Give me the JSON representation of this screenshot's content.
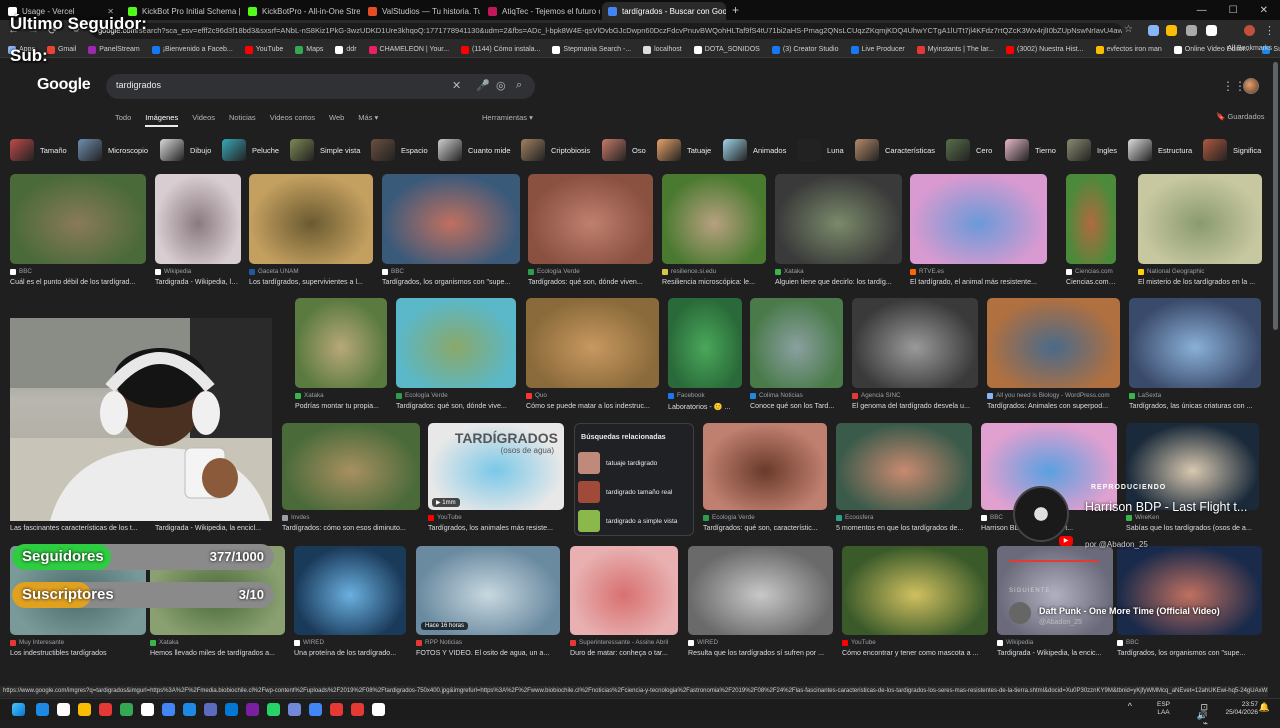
{
  "browser": {
    "tabs": [
      {
        "title": "Usage - Vercel",
        "color": "#ffffff",
        "active": false
      },
      {
        "title": "KickBot Pro Initial Schema | SQL",
        "color": "#53fc18",
        "active": false
      },
      {
        "title": "KickBotPro - All-in-One Stream",
        "color": "#53fc18",
        "active": false
      },
      {
        "title": "ValStudios — Tu historia. Tu cli",
        "color": "#e44d26",
        "active": false
      },
      {
        "title": "AtiqTec - Tejemos el futuro con",
        "color": "#c2185b",
        "active": false
      },
      {
        "title": "tardígrados - Buscar con Google",
        "color": "#4285f4",
        "active": true
      }
    ],
    "new_tab_label": "+",
    "window_controls": [
      "—",
      "☐",
      "✕"
    ],
    "url_host": "google.com",
    "url_rest": "/search?sca_esv=efff2c96d3f18bd3&sxsrf=ANbL-nS8Kiz1PkG-3wzUDKD1Ure3khqoQ:1771778941130&udm=2&fbs=ADc_l-bpk8W4E-qsVlOvbGJcDwpn60DczFdcvPnuvBWQohHLTaf9fS4tU71bi2aHS-Pmag2QNsLCUqzZKqmjKDQ4UhwYCTgA1lUTt7jl4KFdz7rtQZcK3Wx4rjlI0bZUpNswNrIavU4awiu2122OpNPwAtPVaLTGydP",
    "bookmarks": [
      {
        "label": "Apps",
        "color": "#8ab4f8"
      },
      {
        "label": "Gmail",
        "color": "#ea4335"
      },
      {
        "label": "PanelStream",
        "color": "#9c27b0"
      },
      {
        "label": "¡Bienvenido a Faceb...",
        "color": "#1877f2"
      },
      {
        "label": "YouTube",
        "color": "#ff0000"
      },
      {
        "label": "Maps",
        "color": "#34a853"
      },
      {
        "label": "ddr",
        "color": "#ffffff"
      },
      {
        "label": "CHAMELEON | Your...",
        "color": "#e91e63"
      },
      {
        "label": "(1144) Cómo instala...",
        "color": "#ff0000"
      },
      {
        "label": "Stepmania Search -...",
        "color": "#ffffff"
      },
      {
        "label": "localhost",
        "color": "#dddddd"
      },
      {
        "label": "DOTA_SONIDOS",
        "color": "#ffffff"
      },
      {
        "label": "(3) Creator Studio",
        "color": "#1877f2"
      },
      {
        "label": "Live Producer",
        "color": "#1877f2"
      },
      {
        "label": "Myinstants | The lar...",
        "color": "#e53935"
      },
      {
        "label": "(3002) Nuestra Hist...",
        "color": "#ff0000"
      },
      {
        "label": "evfectos iron man",
        "color": "#fbbc04"
      },
      {
        "label": "Online Video Editor...",
        "color": "#ffffff"
      },
      {
        "label": "Submarine Cable M...",
        "color": "#1e88e5"
      }
    ],
    "all_bookmarks": "All Bookmarks",
    "status_url": "https://www.google.com/imgres?q=tardigrados&imgurl=https%3A%2F%2Fmedia.biobiochile.cl%2Fwp-content%2Fuploads%2F2019%2F08%2Ftardigrados-750x400.jpg&imgrefurl=https%3A%2F%2Fwww.biobiochile.cl%2Fnoticias%2Fciencia-y-tecnologia%2Fastronomia%2F2019%2F08%2F24%2Flas-fascinantes-caracteristicas-de-los-tardigrados-los-seres-mas-resistentes-de-la-tierra.shtml&docid=Xu0P30zznKY9M&tbnid=yKjfyWMMcq_aNEvet=12ahUKEwi-hq5-24gUAxW3r..."
  },
  "google": {
    "logo": "Google",
    "query": "tardigrados",
    "nav": [
      "Todo",
      "Imágenes",
      "Videos",
      "Noticias",
      "Videos cortos",
      "Web",
      "Más ▾"
    ],
    "active_nav": "Imágenes",
    "tools": "Herramientas ▾",
    "saved": "Guardados",
    "chips": [
      {
        "label": "Tamaño",
        "color": "#c04a4a"
      },
      {
        "label": "Microscopio",
        "color": "#6f8fb0"
      },
      {
        "label": "Dibujo",
        "color": "#d9d9d9"
      },
      {
        "label": "Peluche",
        "color": "#3aa7b8"
      },
      {
        "label": "Simple vista",
        "color": "#7d8a55"
      },
      {
        "label": "Espacio",
        "color": "#6a5040"
      },
      {
        "label": "Cuanto mide",
        "color": "#cfcfcf"
      },
      {
        "label": "Criptobiosis",
        "color": "#a08060"
      },
      {
        "label": "Oso",
        "color": "#c77a6a"
      },
      {
        "label": "Tatuaje",
        "color": "#e6a36a"
      },
      {
        "label": "Animados",
        "color": "#9ed3e8"
      },
      {
        "label": "Luna",
        "color": "#222222"
      },
      {
        "label": "Características",
        "color": "#b48a6a"
      },
      {
        "label": "Cero",
        "color": "#59704a"
      },
      {
        "label": "Tierno",
        "color": "#e6b8c8"
      },
      {
        "label": "Ingles",
        "color": "#8c8c70"
      },
      {
        "label": "Estructura",
        "color": "#dddddd"
      },
      {
        "label": "Significa",
        "color": "#b0593e"
      }
    ],
    "results": [
      {
        "source": "BBC",
        "title": "Cuál es el punto débil de los tardígrad...",
        "fav": "#ffffff",
        "g": "#4a6a3a,#8a7a5a"
      },
      {
        "source": "Wikipedia",
        "title": "Tardigrada - Wikipedia, la encicl...",
        "fav": "#ffffff",
        "g": "#d8cdd0,#8a7a80"
      },
      {
        "source": "Gaceta UNAM",
        "title": "Los tardígrados, supervivientes a l...",
        "fav": "#1e5aa0",
        "g": "#c4a060,#6a5a30"
      },
      {
        "source": "BBC",
        "title": "Tardígrados, los organismos con \"supe...",
        "fav": "#ffffff",
        "g": "#3a5a7a,#c07060"
      },
      {
        "source": "Ecología Verde",
        "title": "Tardígrados: qué son, dónde viven...",
        "fav": "#2e9d4a",
        "g": "#8a5040,#c08070"
      },
      {
        "source": "resilience.si.edu",
        "title": "Resiliencia microscópica: le...",
        "fav": "#d9c640",
        "g": "#4a7a30,#b8a080"
      },
      {
        "source": "Xataka",
        "title": "Alguien tiene que decirlo: los tardíg...",
        "fav": "#39b54a",
        "g": "#3a3a3a,#7a8a6a"
      },
      {
        "source": "RTVE.es",
        "title": "El tardígrado, el animal más resistente...",
        "fav": "#ff6600",
        "g": "#d89ad0,#6a9ad8"
      },
      {
        "source": "Ciencias.com",
        "title": "Ciencias.com: Lo...",
        "fav": "#ffffff",
        "g": "#4a8a3a,#b06a40"
      },
      {
        "source": "National Geographic",
        "title": "El misterio de los tardígrados en la ...",
        "fav": "#ffd400",
        "g": "#c8c8a0,#8a9a70"
      },
      {
        "source": "Xataka",
        "title": "Podrías montar tu propia...",
        "fav": "#39b54a",
        "g": "#5a7a40,#b8a878"
      },
      {
        "source": "Ecología Verde",
        "title": "Tardígrados: qué son, dónde vive...",
        "fav": "#2e9d4a",
        "g": "#5ab8c8,#8aa86a"
      },
      {
        "source": "Quo",
        "title": "Cómo se puede matar a los indestruc...",
        "fav": "#ff3333",
        "g": "#8a6a3a,#c89860"
      },
      {
        "source": "Facebook",
        "title": "Laboratorios - 🙂 ...",
        "fav": "#1877f2",
        "g": "#2a6a3a,#4aa85a"
      },
      {
        "source": "Colima Noticias",
        "title": "Conoce qué son los Tard...",
        "fav": "#1e88e5",
        "g": "#4a7a4a,#8aa0a0"
      },
      {
        "source": "Agencia SINC",
        "title": "El genoma del tardígrado desvela u...",
        "fav": "#e53935",
        "g": "#3a3a3a,#9a9a9a"
      },
      {
        "source": "All you need is Biology - WordPress.com",
        "title": "Tardígrados: Animales con superpod...",
        "fav": "#8ab4f8",
        "g": "#b07040,#4a6a8a"
      },
      {
        "source": "LaSexta",
        "title": "Tardígrados, las únicas criaturas con ...",
        "fav": "#39b54a",
        "g": "#3a4a6a,#8ab0d8"
      },
      {
        "source": "",
        "title": "Las fascinantes características de los t...",
        "fav": "#ffffff",
        "g": "#8a8a8a,#5a5a5a"
      },
      {
        "source": "",
        "title": "Tardigrada - Wikipedia, la encicl...",
        "fav": "#ffffff",
        "g": "#8a8aa0,#5a5a6a"
      },
      {
        "source": "Invdes",
        "title": "Tardígrados: cómo son esos diminuto...",
        "fav": "#9aa0a6",
        "g": "#4a6a3a,#a89060"
      },
      {
        "source": "YouTube",
        "title": "Tardígrados, los animales más resiste...",
        "fav": "#ff0000",
        "g": "#e8e8e8,#7ac8e8"
      },
      {
        "source": "Ecología Verde",
        "title": "Tardígrados: qué son, característic...",
        "fav": "#2e9d4a",
        "g": "#c08070,#6a3a2a"
      },
      {
        "source": "Ecoosfera",
        "title": "5 momentos en que los tardígrados de...",
        "fav": "#2e9d8a",
        "g": "#3a5a4a,#c88a70"
      },
      {
        "source": "BBC",
        "title": "Harrison BDP - Last Flight t...",
        "fav": "#ffffff",
        "g": "#e0a0d0,#5aa0e0"
      },
      {
        "source": "WireKen",
        "title": "Sabías que los tardígrados (osos de a...",
        "fav": "#39b54a",
        "g": "#1a2a3a,#d8c8b0"
      },
      {
        "source": "Muy Interesante",
        "title": "Los indestructibles tardígrados",
        "fav": "#e53935",
        "g": "#7a9a9a,#4a6a6a"
      },
      {
        "source": "Xataka",
        "title": "Hemos llevado miles de tardígrados a...",
        "fav": "#39b54a",
        "g": "#8aa070,#4a6a3a"
      },
      {
        "source": "WIRED",
        "title": "Una proteína de los tardígrado...",
        "fav": "#ffffff",
        "g": "#1a3a5a,#6ab0e0"
      },
      {
        "source": "RPP Noticias",
        "title": "FOTOS Y VIDEO. El osito de agua, un a...",
        "fav": "#e53935",
        "g": "#6a8aa0,#c8d8e0"
      },
      {
        "source": "Superinteressante - Assine Abril",
        "title": "Duro de matar: conheça o tar...",
        "fav": "#e53935",
        "g": "#e8b0b0,#d87070"
      },
      {
        "source": "WIRED",
        "title": "Resulta que los tardígrados sí sufren por ...",
        "fav": "#ffffff",
        "g": "#6a6a6a,#c8c8c8"
      },
      {
        "source": "YouTube",
        "title": "Cómo encontrar y tener como mascota a ...",
        "fav": "#ff0000",
        "g": "#3a5a2a,#d0c060"
      },
      {
        "source": "Wikipedia",
        "title": "Tardigrada - Wikipedia, la encic...",
        "fav": "#ffffff",
        "g": "#6a6a7a,#b0b0c0"
      },
      {
        "source": "BBC",
        "title": "Tardígrados, los organismos con \"supe...",
        "fav": "#ffffff",
        "g": "#1a2a4a,#c07060"
      }
    ],
    "badges": {
      "r2_time": "1mm",
      "r4_hace": "Hace 16 horas"
    },
    "image_overlay_text": {
      "title": "TARDÍGRADOS",
      "subtitle": "(osos de agua)"
    },
    "related": {
      "title": "Búsquedas relacionadas",
      "items": [
        {
          "label": "tatuaje tardigrado",
          "color": "#c08a7a"
        },
        {
          "label": "tardigrado tamaño real",
          "color": "#a04a3a"
        },
        {
          "label": "tardigrado a simple vista",
          "color": "#8ab84a"
        }
      ]
    }
  },
  "stream_overlay": {
    "last_follower": "Último Seguidor: ",
    "last_sub": "Sub: ",
    "followers_label": "Seguidores",
    "followers_count": "377/1000",
    "followers_fraction": 0.377,
    "followers_color": "#2ecc40",
    "subs_label": "Suscriptores",
    "subs_count": "3/10",
    "subs_fraction": 0.3,
    "subs_color": "#e0a020",
    "now_playing_label": "REPRODUCIENDO",
    "now_playing_title": "Harrison BDP - Last Flight t...",
    "now_playing_by": "por @Abadon_25",
    "next_label": "SIGUIENTE",
    "next_title": "Daft Punk - One More Time (Official Video)",
    "next_by": "@Abadon_25"
  },
  "taskbar": {
    "lang": "ESP",
    "layout": "LAA",
    "time": "23:57",
    "date": "25/04/2026",
    "apps": [
      "#1e88e5",
      "#ffffff",
      "#fbbc04",
      "#e53935",
      "#34a853",
      "#ffffff",
      "#4285f4",
      "#1e88e5",
      "#5c6bc0",
      "#0078d4",
      "#7b1fa2",
      "#25d366",
      "#7289da",
      "#4285f4",
      "#e53935",
      "#e53935",
      "#ffffff"
    ]
  }
}
